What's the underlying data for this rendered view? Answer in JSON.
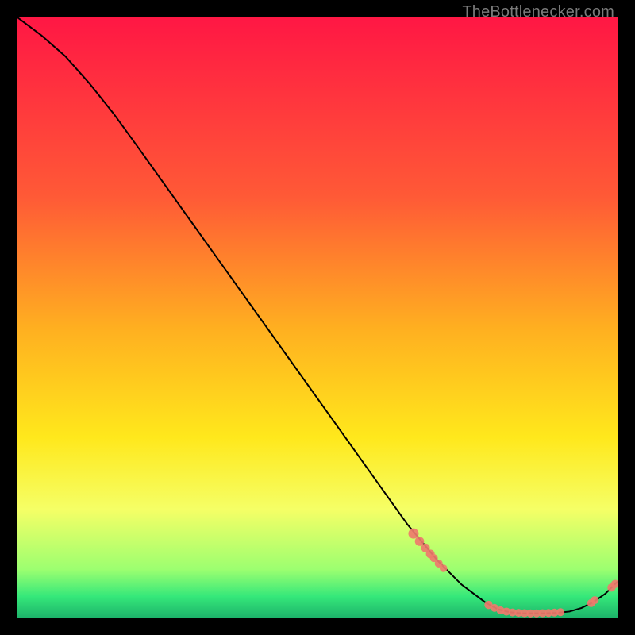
{
  "source_label": "TheBottlenecker.com",
  "chart_data": {
    "type": "line",
    "title": "",
    "xlabel": "",
    "ylabel": "",
    "xlim": [
      0,
      100
    ],
    "ylim": [
      0,
      100
    ],
    "gradient_stops": [
      {
        "offset": 0,
        "color": "#ff1744"
      },
      {
        "offset": 0.3,
        "color": "#ff5a36"
      },
      {
        "offset": 0.52,
        "color": "#ffb020"
      },
      {
        "offset": 0.7,
        "color": "#ffe81c"
      },
      {
        "offset": 0.82,
        "color": "#f5ff66"
      },
      {
        "offset": 0.92,
        "color": "#9cff70"
      },
      {
        "offset": 0.965,
        "color": "#35e87a"
      },
      {
        "offset": 1.0,
        "color": "#1db36a"
      }
    ],
    "series": [
      {
        "name": "bottleneck-curve",
        "color": "#000000",
        "x": [
          0,
          4,
          8,
          12,
          16,
          20,
          25,
          30,
          35,
          40,
          45,
          50,
          55,
          60,
          65,
          70,
          74,
          78,
          80,
          82,
          84,
          86,
          88,
          90,
          92,
          94,
          96,
          98,
          100
        ],
        "y": [
          100,
          97,
          93.5,
          89,
          84,
          78.5,
          71.5,
          64.5,
          57.5,
          50.5,
          43.5,
          36.5,
          29.5,
          22.5,
          15.5,
          9.5,
          5.5,
          2.5,
          1.4,
          0.9,
          0.7,
          0.7,
          0.7,
          0.8,
          1.0,
          1.6,
          2.6,
          4.0,
          6.0
        ]
      }
    ],
    "markers": {
      "name": "data-points",
      "color": "#ee7b6c",
      "radius_default": 5.2,
      "points": [
        {
          "x": 66,
          "y": 14.0,
          "r": 6.5
        },
        {
          "x": 67,
          "y": 12.7,
          "r": 5.8
        },
        {
          "x": 68,
          "y": 11.6,
          "r": 5.5
        },
        {
          "x": 68.8,
          "y": 10.6,
          "r": 5.5
        },
        {
          "x": 69.4,
          "y": 9.9,
          "r": 5.0
        },
        {
          "x": 70.2,
          "y": 9.0,
          "r": 5.0
        },
        {
          "x": 71.0,
          "y": 8.2,
          "r": 4.8
        },
        {
          "x": 78.5,
          "y": 2.1,
          "r": 5.2
        },
        {
          "x": 79.5,
          "y": 1.6,
          "r": 5.0
        },
        {
          "x": 80.5,
          "y": 1.2,
          "r": 5.0
        },
        {
          "x": 81.5,
          "y": 1.0,
          "r": 5.0
        },
        {
          "x": 82.5,
          "y": 0.85,
          "r": 5.0
        },
        {
          "x": 83.5,
          "y": 0.78,
          "r": 5.0
        },
        {
          "x": 84.5,
          "y": 0.72,
          "r": 5.0
        },
        {
          "x": 85.5,
          "y": 0.7,
          "r": 5.0
        },
        {
          "x": 86.5,
          "y": 0.7,
          "r": 5.0
        },
        {
          "x": 87.5,
          "y": 0.72,
          "r": 5.0
        },
        {
          "x": 88.5,
          "y": 0.76,
          "r": 5.0
        },
        {
          "x": 89.5,
          "y": 0.82,
          "r": 5.0
        },
        {
          "x": 90.5,
          "y": 0.9,
          "r": 5.0
        },
        {
          "x": 95.6,
          "y": 2.4,
          "r": 5.0
        },
        {
          "x": 96.2,
          "y": 2.9,
          "r": 5.0
        },
        {
          "x": 99.0,
          "y": 5.0,
          "r": 5.2
        },
        {
          "x": 99.6,
          "y": 5.6,
          "r": 5.2
        }
      ]
    }
  }
}
